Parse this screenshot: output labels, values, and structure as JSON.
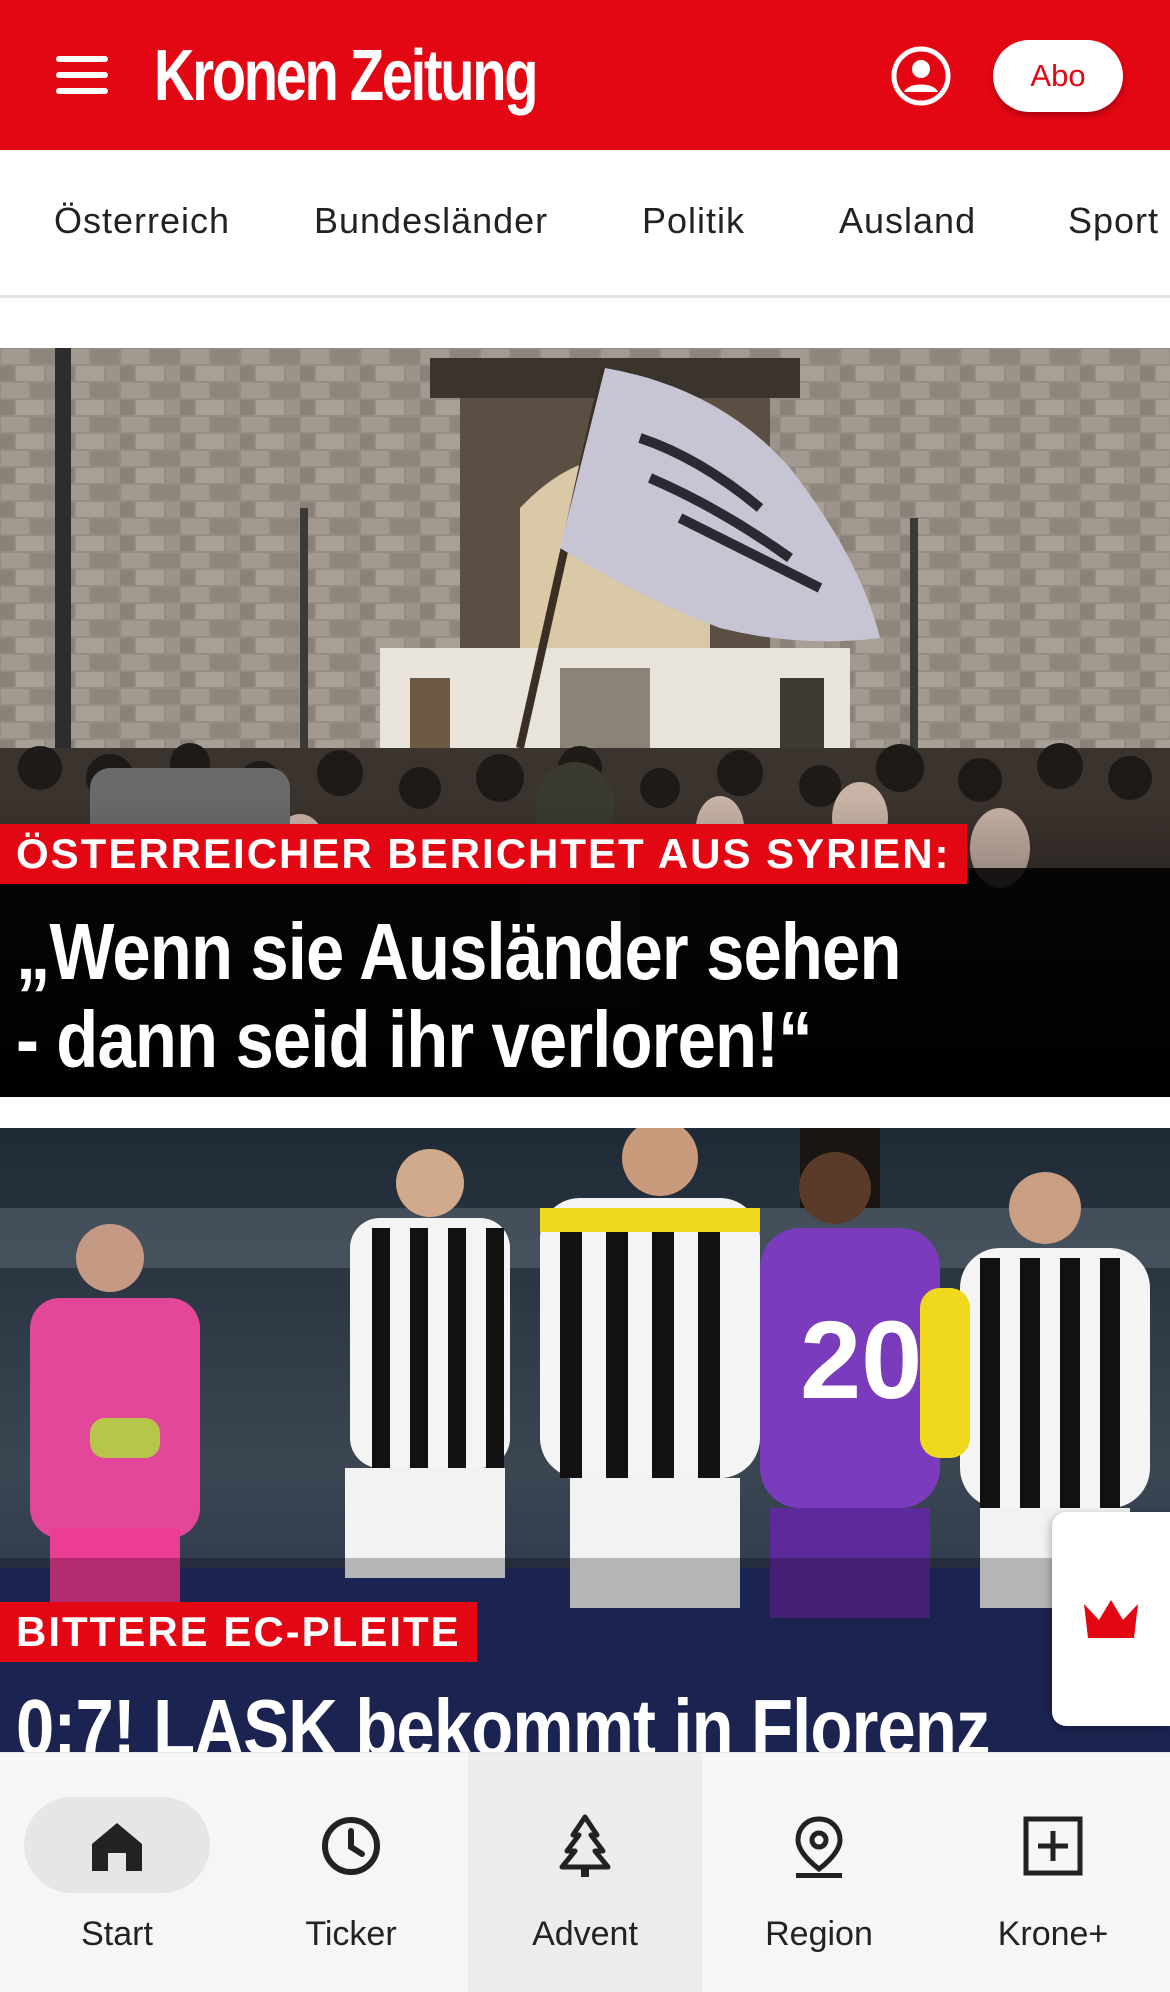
{
  "header": {
    "logo_text": "Kronen Zeitung",
    "abo_label": "Abo",
    "brand_color": "#e30613",
    "menu_icon": "hamburger-menu-icon",
    "user_icon": "user-account-icon"
  },
  "nav": {
    "items": [
      {
        "label": "Österreich"
      },
      {
        "label": "Bundesländer"
      },
      {
        "label": "Politik"
      },
      {
        "label": "Ausland"
      },
      {
        "label": "Sport"
      }
    ]
  },
  "articles": [
    {
      "kicker": "ÖSTERREICHER BERICHTET AUS SYRIEN:",
      "headline_line1": "„Wenn sie Ausländer sehen",
      "headline_line2": "- dann seid ihr verloren!“",
      "image": "crowd with flag in front of mosque wall"
    },
    {
      "kicker": "BITTERE EC-PLEITE",
      "headline_line1": "0:7! LASK bekommt in Florenz",
      "image": "football players on pitch"
    }
  ],
  "side_widget": {
    "icon": "crown-icon"
  },
  "bottom_nav": {
    "items": [
      {
        "label": "Start",
        "icon": "home-icon",
        "active": true
      },
      {
        "label": "Ticker",
        "icon": "clock-icon"
      },
      {
        "label": "Advent",
        "icon": "christmas-tree-icon"
      },
      {
        "label": "Region",
        "icon": "location-pin-icon"
      },
      {
        "label": "Krone+",
        "icon": "plus-square-icon"
      }
    ]
  }
}
